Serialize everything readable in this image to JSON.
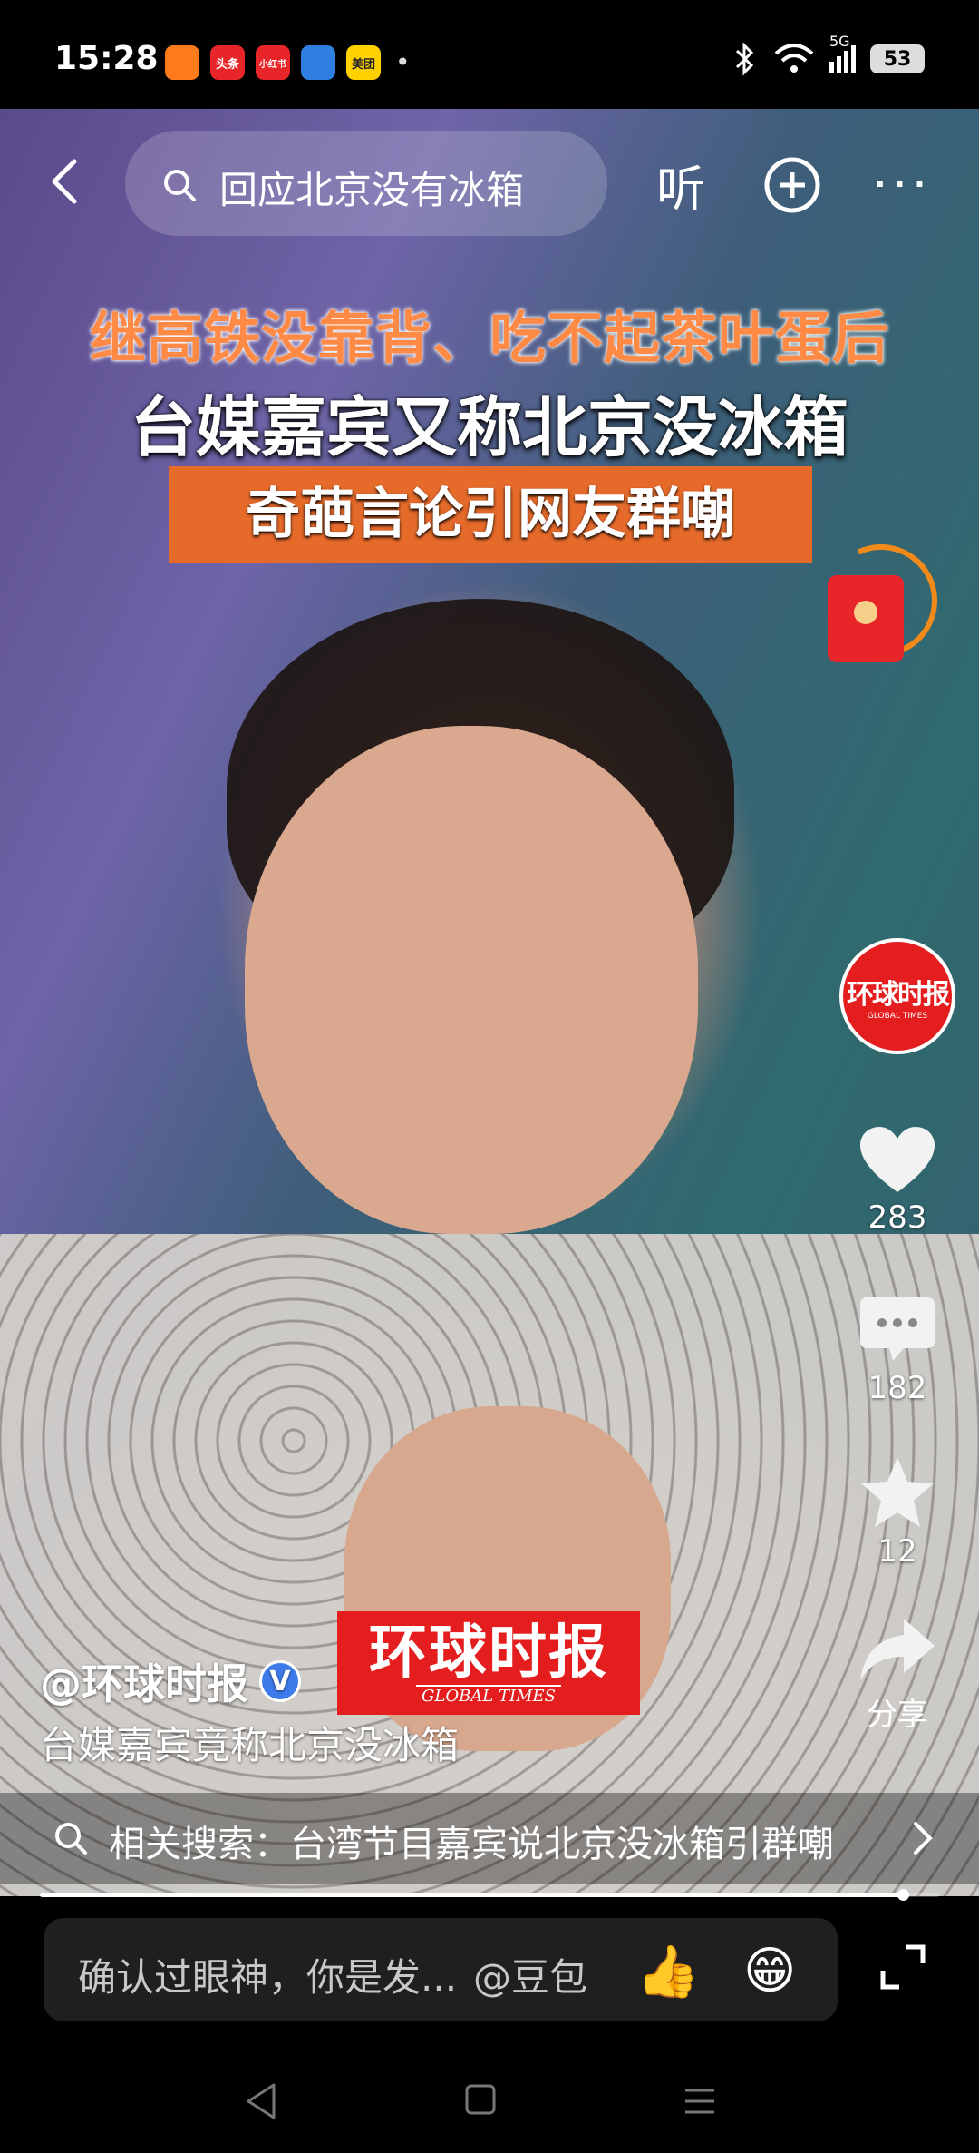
{
  "status_bar": {
    "time": "15:28",
    "app_icons": [
      {
        "name": "video-app-icon",
        "label": "",
        "color": "#ff7a1a"
      },
      {
        "name": "toutiao-app-icon",
        "label": "头条",
        "color": "#e8262a"
      },
      {
        "name": "xiaohongshu-app-icon",
        "label": "小红书",
        "color": "#e8262a"
      },
      {
        "name": "weather-app-icon",
        "label": "",
        "color": "#2f7fe0"
      },
      {
        "name": "meituan-app-icon",
        "label": "美团",
        "color": "#ffd100"
      }
    ],
    "network": "5G",
    "battery": "53"
  },
  "top_bar": {
    "search_text": "回应北京没有冰箱",
    "listen_label": "听"
  },
  "headlines": {
    "line1": "继高铁没靠背、吃不起茶叶蛋后",
    "line2": "台媒嘉宾又称北京没冰箱",
    "line3": "奇葩言论引网友群嘲"
  },
  "rail": {
    "avatar_logo": "环球时报",
    "avatar_sub": "GLOBAL TIMES",
    "likes": "283",
    "comments": "182",
    "favorites": "12",
    "share_label": "分享"
  },
  "caption": {
    "author": "@环球时报",
    "verified_badge": "V",
    "text": "台媒嘉宾竟称北京没冰箱",
    "watermark_cn": "环球时报",
    "watermark_en": "GLOBAL TIMES"
  },
  "related_search": {
    "text": "相关搜索：台湾节目嘉宾说北京没冰箱引群嘲"
  },
  "progress": 0.96,
  "comment_input": {
    "placeholder": "确认过眼神，你是发...",
    "mention": "@豆包",
    "emoji_1": "👍",
    "emoji_2": "😁"
  },
  "colors": {
    "accent_orange": "#e66a2a",
    "brand_red": "#e41e1e",
    "verified_blue": "#3e7bea"
  }
}
